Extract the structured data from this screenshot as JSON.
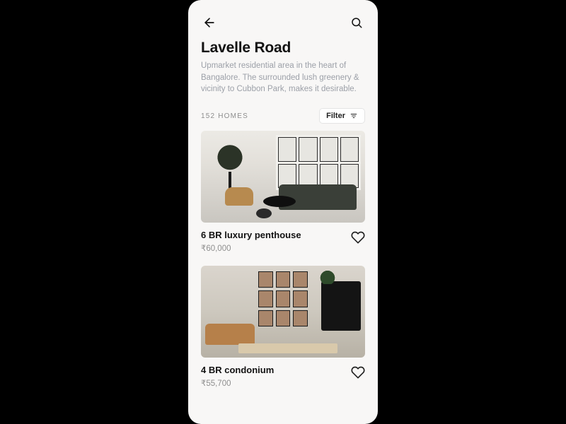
{
  "header": {
    "title": "Lavelle Road",
    "description": "Upmarket residential area in the heart of Bangalore. The surrounded lush greenery & vicinity to Cubbon Park, makes it desirable."
  },
  "count_label": "152 HOMES",
  "filter_label": "Filter",
  "listings": [
    {
      "title": "6 BR luxury penthouse",
      "price": "₹60,000"
    },
    {
      "title": "4 BR condonium",
      "price": "₹55,700"
    }
  ]
}
